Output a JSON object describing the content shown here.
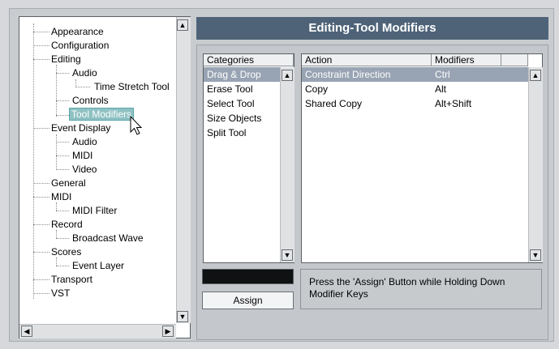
{
  "tree": {
    "items": [
      {
        "label": "Appearance"
      },
      {
        "label": "Configuration"
      },
      {
        "label": "Editing"
      },
      {
        "label": "Audio"
      },
      {
        "label": "Time Stretch Tool"
      },
      {
        "label": "Controls"
      },
      {
        "label": "Tool Modifiers"
      },
      {
        "label": "Event Display"
      },
      {
        "label": "Audio"
      },
      {
        "label": "MIDI"
      },
      {
        "label": "Video"
      },
      {
        "label": "General"
      },
      {
        "label": "MIDI"
      },
      {
        "label": "MIDI Filter"
      },
      {
        "label": "Record"
      },
      {
        "label": "Broadcast Wave"
      },
      {
        "label": "Scores"
      },
      {
        "label": "Event Layer"
      },
      {
        "label": "Transport"
      },
      {
        "label": "VST"
      }
    ],
    "selected": "Tool Modifiers"
  },
  "page": {
    "title": "Editing-Tool Modifiers"
  },
  "categories": {
    "header": "Categories",
    "items": [
      "Drag & Drop",
      "Erase Tool",
      "Select Tool",
      "Size Objects",
      "Split Tool"
    ],
    "selected": "Drag & Drop"
  },
  "actions": {
    "headers": {
      "action": "Action",
      "modifiers": "Modifiers"
    },
    "rows": [
      {
        "action": "Constraint Direction",
        "modifiers": "Ctrl"
      },
      {
        "action": "Copy",
        "modifiers": "Alt"
      },
      {
        "action": "Shared Copy",
        "modifiers": "Alt+Shift"
      }
    ],
    "selected": "Constraint Direction"
  },
  "assign": {
    "label": "Assign",
    "hint": "Press the 'Assign' Button while Holding Down Modifier Keys"
  },
  "colors": {
    "title_bar": "#4e6378",
    "selection_tree": "#8fc1c3",
    "selection_row": "#98a4b3"
  }
}
